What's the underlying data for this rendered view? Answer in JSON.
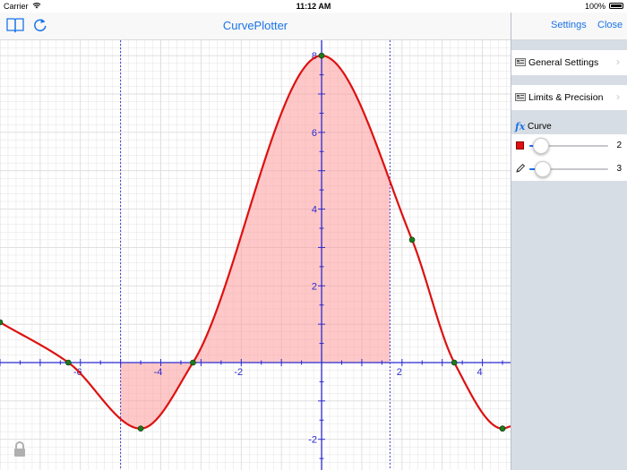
{
  "status_bar": {
    "carrier": "Carrier",
    "time": "11:12 AM",
    "battery": "100%"
  },
  "nav": {
    "title": "CurvePlotter"
  },
  "panel": {
    "settings_label": "Settings",
    "close_label": "Close",
    "general_settings": "General Settings",
    "limits_precision": "Limits & Precision",
    "curve_header": "Curve",
    "curve_color": "#e01010",
    "color_slider": {
      "value_label": "2",
      "fraction": 0.15
    },
    "width_slider": {
      "value_label": "3",
      "fraction": 0.17
    }
  },
  "graph": {
    "x_range": [
      -8,
      4.7
    ],
    "y_range": [
      -2.8,
      8.4
    ],
    "x_tick_labels": [
      "-6",
      "-4",
      "-2",
      "2",
      "4"
    ],
    "y_tick_labels": [
      "-2",
      "2",
      "4",
      "6",
      "8"
    ],
    "fill_limits": [
      -5,
      1.7
    ],
    "curve_color": "#dd1111",
    "fill_color": "#ff9a9a",
    "axis_color": "#2a2ad0",
    "grid_color": "#dcdcdc",
    "marker_color": "#1d7a1d"
  }
}
